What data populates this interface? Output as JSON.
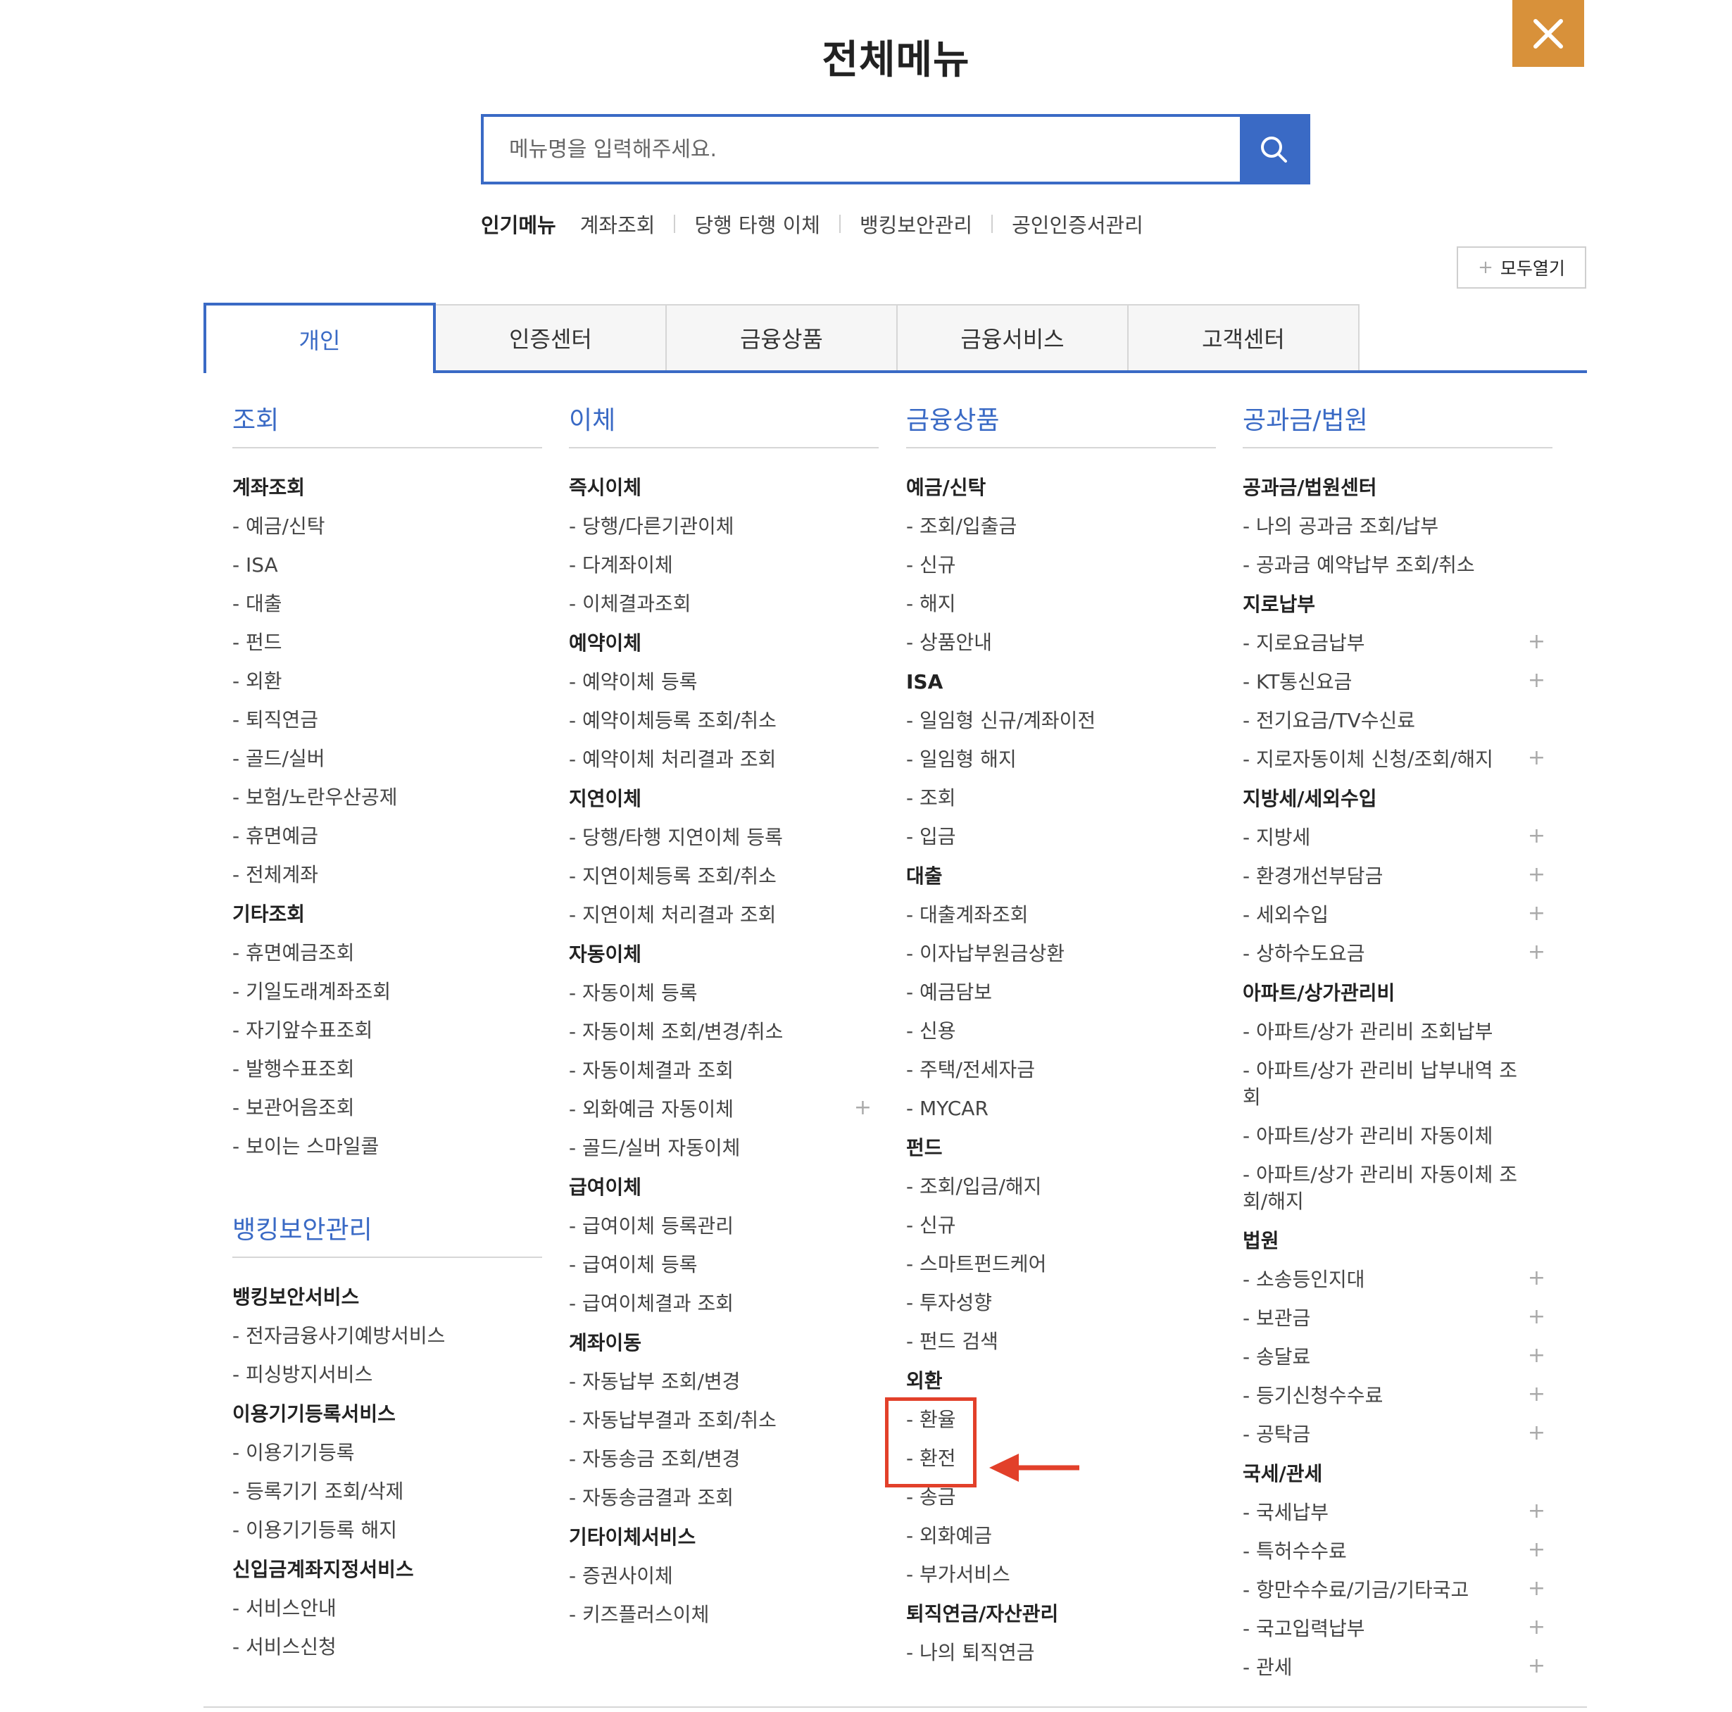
{
  "title": "전체메뉴",
  "close_icon": "close-icon",
  "search": {
    "placeholder": "메뉴명을 입력해주세요.",
    "icon": "search-icon"
  },
  "popular": {
    "label": "인기메뉴",
    "links": [
      "계좌조회",
      "당행 타행 이체",
      "뱅킹보안관리",
      "공인인증서관리"
    ]
  },
  "expand_all": "모두열기",
  "tabs": [
    {
      "label": "개인",
      "active": true
    },
    {
      "label": "인증센터"
    },
    {
      "label": "금융상품"
    },
    {
      "label": "금융서비스"
    },
    {
      "label": "고객센터"
    }
  ],
  "colors": {
    "accent": "#3a6ac5",
    "close_bg": "#d8913a",
    "highlight": "#e2402a"
  },
  "columns": [
    {
      "sections": [
        {
          "title": "조회",
          "groups": [
            {
              "title": "계좌조회",
              "items": [
                {
                  "label": "- 예금/신탁"
                },
                {
                  "label": "- ISA"
                },
                {
                  "label": "- 대출"
                },
                {
                  "label": "- 펀드"
                },
                {
                  "label": "- 외환"
                },
                {
                  "label": "- 퇴직연금"
                },
                {
                  "label": "- 골드/실버"
                },
                {
                  "label": "- 보험/노란우산공제"
                },
                {
                  "label": "- 휴면예금"
                },
                {
                  "label": "- 전체계좌"
                }
              ]
            },
            {
              "title": "기타조회",
              "items": [
                {
                  "label": "- 휴면예금조회"
                },
                {
                  "label": "- 기일도래계좌조회"
                },
                {
                  "label": "- 자기앞수표조회"
                },
                {
                  "label": "- 발행수표조회"
                },
                {
                  "label": "- 보관어음조회"
                },
                {
                  "label": "- 보이는 스마일콜"
                }
              ]
            }
          ]
        },
        {
          "title": "뱅킹보안관리",
          "groups": [
            {
              "title": "뱅킹보안서비스",
              "items": [
                {
                  "label": "- 전자금융사기예방서비스"
                },
                {
                  "label": "- 피싱방지서비스"
                }
              ]
            },
            {
              "title": "이용기기등록서비스",
              "items": [
                {
                  "label": "- 이용기기등록"
                },
                {
                  "label": "- 등록기기 조회/삭제"
                },
                {
                  "label": "- 이용기기등록 해지"
                }
              ]
            },
            {
              "title": "신입금계좌지정서비스",
              "items": [
                {
                  "label": "- 서비스안내"
                },
                {
                  "label": "- 서비스신청"
                }
              ]
            }
          ]
        }
      ]
    },
    {
      "sections": [
        {
          "title": "이체",
          "groups": [
            {
              "title": "즉시이체",
              "items": [
                {
                  "label": "- 당행/다른기관이체"
                },
                {
                  "label": "- 다계좌이체"
                },
                {
                  "label": "- 이체결과조회"
                }
              ]
            },
            {
              "title": "예약이체",
              "items": [
                {
                  "label": "- 예약이체 등록"
                },
                {
                  "label": "- 예약이체등록 조회/취소"
                },
                {
                  "label": "- 예약이체 처리결과 조회"
                }
              ]
            },
            {
              "title": "지연이체",
              "items": [
                {
                  "label": "- 당행/타행 지연이체 등록"
                },
                {
                  "label": "- 지연이체등록 조회/취소"
                },
                {
                  "label": "- 지연이체 처리결과 조회"
                }
              ]
            },
            {
              "title": "자동이체",
              "items": [
                {
                  "label": "- 자동이체 등록"
                },
                {
                  "label": "- 자동이체 조회/변경/취소"
                },
                {
                  "label": "- 자동이체결과 조회"
                },
                {
                  "label": "- 외화예금 자동이체",
                  "plus": true
                },
                {
                  "label": "- 골드/실버 자동이체"
                }
              ]
            },
            {
              "title": "급여이체",
              "items": [
                {
                  "label": "- 급여이체 등록관리"
                },
                {
                  "label": "- 급여이체 등록"
                },
                {
                  "label": "- 급여이체결과 조회"
                }
              ]
            },
            {
              "title": "계좌이동",
              "items": [
                {
                  "label": "- 자동납부 조회/변경"
                },
                {
                  "label": "- 자동납부결과 조회/취소"
                },
                {
                  "label": "- 자동송금 조회/변경"
                },
                {
                  "label": "- 자동송금결과 조회"
                }
              ]
            },
            {
              "title": "기타이체서비스",
              "items": [
                {
                  "label": "- 증권사이체"
                },
                {
                  "label": "- 키즈플러스이체"
                }
              ]
            }
          ]
        }
      ]
    },
    {
      "sections": [
        {
          "title": "금융상품",
          "groups": [
            {
              "title": "예금/신탁",
              "items": [
                {
                  "label": "- 조회/입출금"
                },
                {
                  "label": "- 신규"
                },
                {
                  "label": "- 해지"
                },
                {
                  "label": "- 상품안내"
                }
              ]
            },
            {
              "title": "ISA",
              "items": [
                {
                  "label": "- 일임형 신규/계좌이전"
                },
                {
                  "label": "- 일임형 해지"
                },
                {
                  "label": "- 조회"
                },
                {
                  "label": "- 입금"
                }
              ]
            },
            {
              "title": "대출",
              "items": [
                {
                  "label": "- 대출계좌조회"
                },
                {
                  "label": "- 이자납부원금상환"
                },
                {
                  "label": "- 예금담보"
                },
                {
                  "label": "- 신용"
                },
                {
                  "label": "- 주택/전세자금"
                },
                {
                  "label": "- MYCAR"
                }
              ]
            },
            {
              "title": "펀드",
              "items": [
                {
                  "label": "- 조회/입금/해지"
                },
                {
                  "label": "- 신규"
                },
                {
                  "label": "- 스마트펀드케어"
                },
                {
                  "label": "- 투자성향"
                },
                {
                  "label": "- 펀드 검색"
                }
              ]
            },
            {
              "title": "외환",
              "items": [
                {
                  "label": "- 환율"
                },
                {
                  "label": "- 환전"
                },
                {
                  "label": "- 송금"
                },
                {
                  "label": "- 외화예금"
                },
                {
                  "label": "- 부가서비스"
                }
              ]
            },
            {
              "title": "퇴직연금/자산관리",
              "items": [
                {
                  "label": "- 나의 퇴직연금"
                }
              ]
            }
          ]
        }
      ]
    },
    {
      "sections": [
        {
          "title": "공과금/법원",
          "groups": [
            {
              "title": "공과금/법원센터",
              "items": [
                {
                  "label": "- 나의 공과금 조회/납부"
                },
                {
                  "label": "- 공과금 예약납부 조회/취소"
                }
              ]
            },
            {
              "title": "지로납부",
              "items": [
                {
                  "label": "- 지로요금납부",
                  "plus": true
                },
                {
                  "label": "- KT통신요금",
                  "plus": true
                },
                {
                  "label": "- 전기요금/TV수신료"
                },
                {
                  "label": "- 지로자동이체 신청/조회/해지",
                  "plus": true
                }
              ]
            },
            {
              "title": "지방세/세외수입",
              "items": [
                {
                  "label": "- 지방세",
                  "plus": true
                },
                {
                  "label": "- 환경개선부담금",
                  "plus": true
                },
                {
                  "label": "- 세외수입",
                  "plus": true
                },
                {
                  "label": "- 상하수도요금",
                  "plus": true
                }
              ]
            },
            {
              "title": "아파트/상가관리비",
              "items": [
                {
                  "label": "- 아파트/상가 관리비 조회납부"
                },
                {
                  "label": "- 아파트/상가 관리비 납부내역 조회"
                },
                {
                  "label": "- 아파트/상가 관리비 자동이체"
                },
                {
                  "label": "- 아파트/상가 관리비 자동이체 조회/해지"
                }
              ]
            },
            {
              "title": "법원",
              "items": [
                {
                  "label": "- 소송등인지대",
                  "plus": true
                },
                {
                  "label": "- 보관금",
                  "plus": true
                },
                {
                  "label": "- 송달료",
                  "plus": true
                },
                {
                  "label": "- 등기신청수수료",
                  "plus": true
                },
                {
                  "label": "- 공탁금",
                  "plus": true
                }
              ]
            },
            {
              "title": "국세/관세",
              "items": [
                {
                  "label": "- 국세납부",
                  "plus": true
                },
                {
                  "label": "- 특허수수료",
                  "plus": true
                },
                {
                  "label": "- 항만수수료/기금/기타국고",
                  "plus": true
                },
                {
                  "label": "- 국고입력납부",
                  "plus": true
                },
                {
                  "label": "- 관세",
                  "plus": true
                }
              ]
            }
          ]
        }
      ]
    }
  ]
}
